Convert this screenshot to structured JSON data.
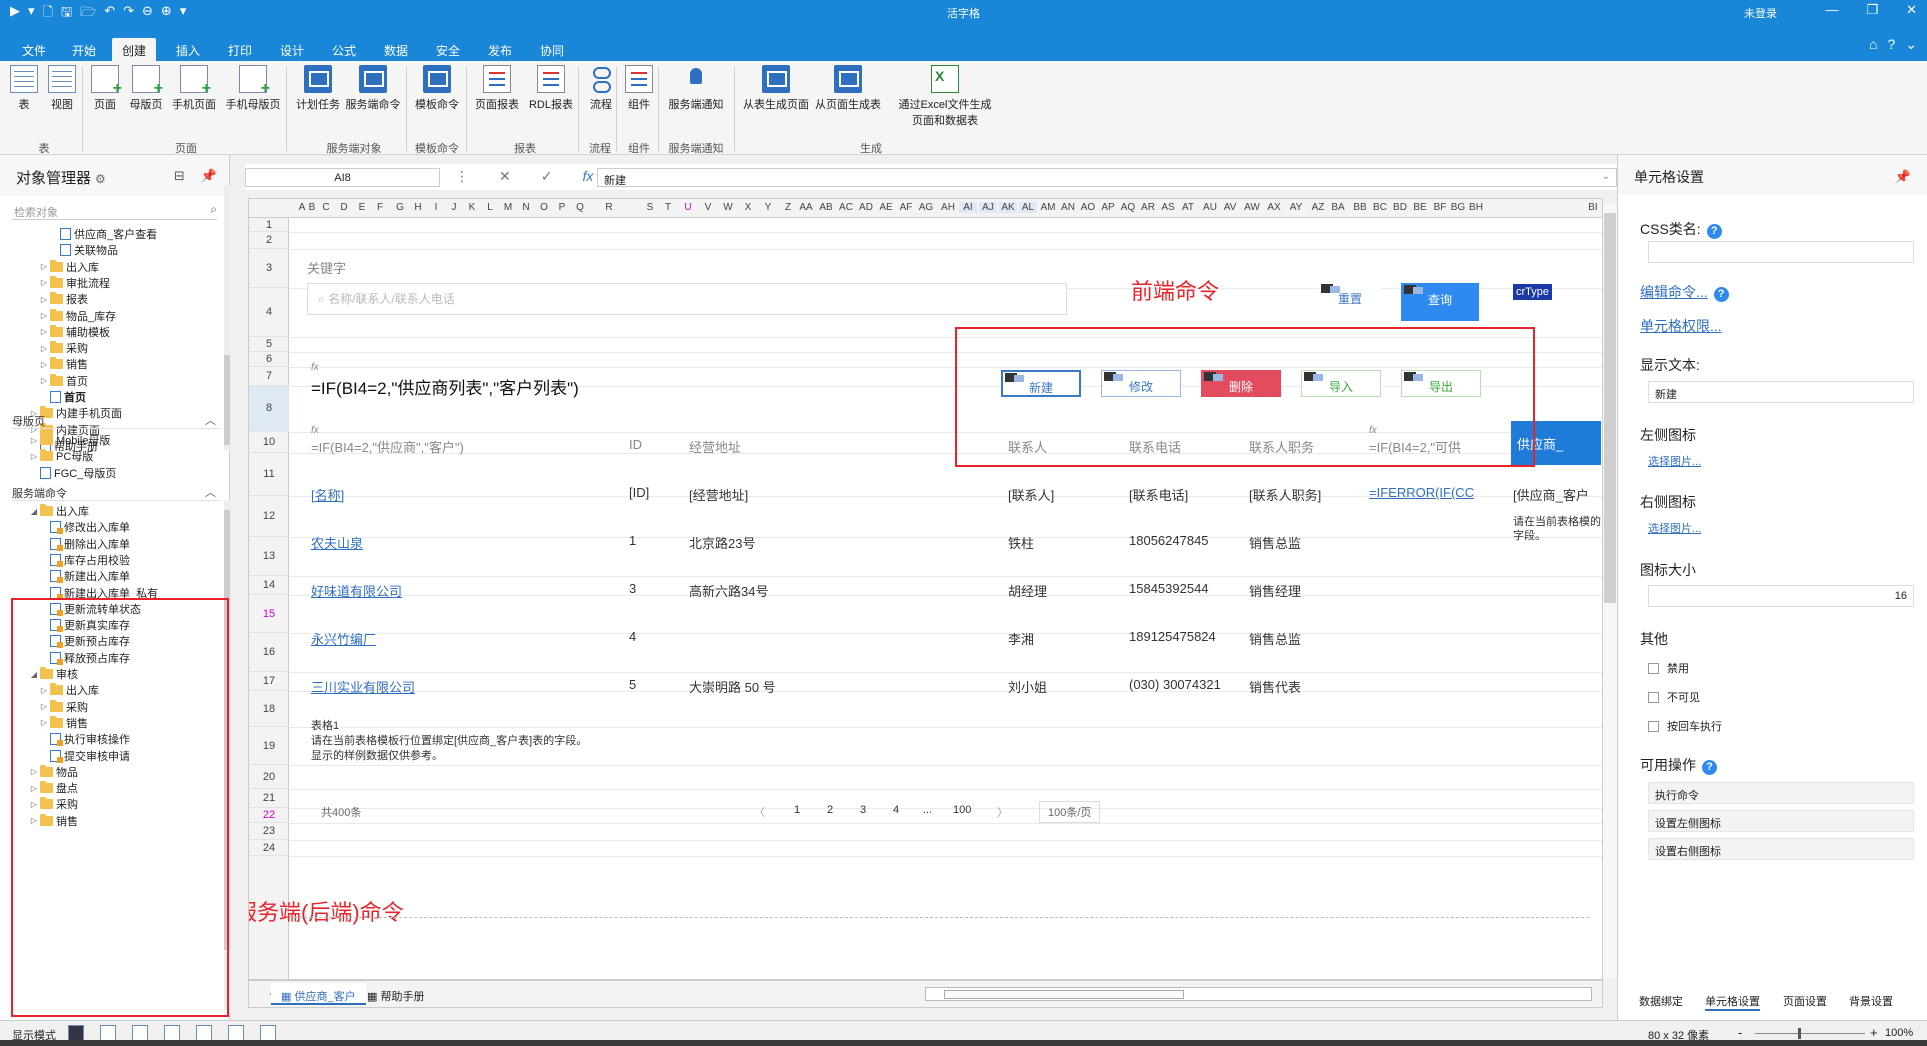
{
  "app": {
    "title": "活字格",
    "login_status": "未登录",
    "window_buttons": [
      "—",
      "❐",
      "✕"
    ]
  },
  "quick_access": [
    "▶",
    "▾",
    "🗋",
    "🖫",
    "🗁",
    "↶",
    "↷",
    "⊖",
    "⊕",
    "▾"
  ],
  "ribbon_tabs": [
    "文件",
    "开始",
    "创建",
    "插入",
    "打印",
    "设计",
    "公式",
    "数据",
    "安全",
    "发布",
    "协同"
  ],
  "ribbon_right_icons": [
    "⌂",
    "?",
    "⌄"
  ],
  "ribbon": {
    "buttons": [
      {
        "label": "表",
        "icon": "sheet-icon"
      },
      {
        "label": "视图",
        "icon": "view-icon"
      },
      {
        "label": "页面",
        "icon": "page-icon"
      },
      {
        "label": "母版页",
        "icon": "master-page-icon"
      },
      {
        "label": "手机页面",
        "icon": "mobile-page-icon"
      },
      {
        "label": "手机母版页",
        "icon": "mobile-master-icon"
      },
      {
        "label": "计划任务",
        "icon": "schedule-icon"
      },
      {
        "label": "服务端命令",
        "icon": "server-command-icon"
      },
      {
        "label": "模板命令",
        "icon": "template-command-icon"
      },
      {
        "label": "页面报表",
        "icon": "page-report-icon"
      },
      {
        "label": "RDL报表",
        "icon": "rdl-report-icon"
      },
      {
        "label": "流程",
        "icon": "flow-icon"
      },
      {
        "label": "组件",
        "icon": "component-icon"
      },
      {
        "label": "服务端通知",
        "icon": "notification-icon"
      },
      {
        "label": "从表生成页面",
        "icon": "gen-from-table-icon"
      },
      {
        "label": "从页面生成表",
        "icon": "gen-from-page-icon"
      },
      {
        "label": "通过Excel文件生成",
        "label2": "页面和数据表",
        "icon": "excel-icon"
      }
    ],
    "groups": [
      "表",
      "页面",
      "服务端对象",
      "模板命令",
      "报表",
      "流程",
      "组件",
      "服务端通知",
      "生成"
    ]
  },
  "object_manager": {
    "title": "对象管理器",
    "search_placeholder": "检索对象",
    "top_items": [
      {
        "label": "供应商_客户查看",
        "type": "page",
        "indent": 3
      },
      {
        "label": "关联物品",
        "type": "page",
        "indent": 3
      },
      {
        "label": "出入库",
        "type": "folder",
        "indent": 2
      },
      {
        "label": "审批流程",
        "type": "folder",
        "indent": 2
      },
      {
        "label": "报表",
        "type": "folder",
        "indent": 2
      },
      {
        "label": "物品_库存",
        "type": "folder",
        "indent": 2
      },
      {
        "label": "辅助模板",
        "type": "folder",
        "indent": 2
      },
      {
        "label": "采购",
        "type": "folder",
        "indent": 2
      },
      {
        "label": "销售",
        "type": "folder",
        "indent": 2
      },
      {
        "label": "首页",
        "type": "folder",
        "indent": 2
      },
      {
        "label": "首页",
        "type": "page",
        "indent": 2,
        "bold": true
      },
      {
        "label": "内建手机页面",
        "type": "folder",
        "indent": 1
      },
      {
        "label": "内建页面",
        "type": "folder",
        "indent": 1
      },
      {
        "label": "帮助手册",
        "type": "page",
        "indent": 1
      }
    ],
    "master_section": "母版页",
    "master_items": [
      {
        "label": "Mobile母版",
        "type": "folder",
        "indent": 1
      },
      {
        "label": "PC母版",
        "type": "folder",
        "indent": 1
      },
      {
        "label": "FGC_母版页",
        "type": "page",
        "indent": 1
      }
    ],
    "server_section": "服务端命令",
    "server_items": [
      {
        "label": "出入库",
        "type": "folder",
        "indent": 1,
        "open": true
      },
      {
        "label": "修改出入库单",
        "type": "cmd",
        "indent": 2
      },
      {
        "label": "删除出入库单",
        "type": "cmd",
        "indent": 2
      },
      {
        "label": "库存占用校验",
        "type": "cmd",
        "indent": 2
      },
      {
        "label": "新建出入库单",
        "type": "cmd",
        "indent": 2
      },
      {
        "label": "新建出入库单_私有",
        "type": "cmd",
        "indent": 2
      },
      {
        "label": "更新流转单状态",
        "type": "cmd",
        "indent": 2
      },
      {
        "label": "更新真实库存",
        "type": "cmd",
        "indent": 2
      },
      {
        "label": "更新预占库存",
        "type": "cmd",
        "indent": 2
      },
      {
        "label": "释放预占库存",
        "type": "cmd",
        "indent": 2
      },
      {
        "label": "审核",
        "type": "folder",
        "indent": 1,
        "open": true
      },
      {
        "label": "出入库",
        "type": "folder",
        "indent": 2
      },
      {
        "label": "采购",
        "type": "folder",
        "indent": 2
      },
      {
        "label": "销售",
        "type": "folder",
        "indent": 2
      },
      {
        "label": "执行审核操作",
        "type": "cmd",
        "indent": 2
      },
      {
        "label": "提交审核申请",
        "type": "cmd",
        "indent": 2
      },
      {
        "label": "物品",
        "type": "folder",
        "indent": 1
      },
      {
        "label": "盘点",
        "type": "folder",
        "indent": 1
      },
      {
        "label": "采购",
        "type": "folder",
        "indent": 1
      },
      {
        "label": "销售",
        "type": "folder",
        "indent": 1
      }
    ]
  },
  "formula_bar": {
    "cell_name": "AI8",
    "value": "新建"
  },
  "columns": [
    "A",
    "B",
    "C",
    "D",
    "E",
    "F",
    "G",
    "H",
    "I",
    "J",
    "K",
    "L",
    "M",
    "N",
    "O",
    "P",
    "Q",
    "R",
    "S",
    "T",
    "U",
    "V",
    "W",
    "X",
    "Y",
    "Z",
    "AA",
    "AB",
    "AC",
    "AD",
    "AE",
    "AF",
    "AG",
    "AH",
    "AI",
    "AJ",
    "AK",
    "AL",
    "AM",
    "AN",
    "AO",
    "AP",
    "AQ",
    "AR",
    "AS",
    "AT",
    "AU",
    "AV",
    "AW",
    "AX",
    "AY",
    "AZ",
    "BA",
    "BB",
    "BC",
    "BD",
    "BE",
    "BF",
    "BG",
    "BH",
    "BI"
  ],
  "rows": [
    "1",
    "2",
    "3",
    "4",
    "5",
    "6",
    "7",
    "8",
    "10",
    "11",
    "12",
    "13",
    "14",
    "15",
    "16",
    "17",
    "18",
    "19",
    "20",
    "21",
    "22",
    "23",
    "24"
  ],
  "sheet": {
    "keyword_label": "关键字",
    "search_placeholder": "名称/联系人/联系人电话",
    "formula_title": "=IF(BI4=2,\"供应商列表\",\"客户列表\")",
    "buttons": {
      "reset": "重置",
      "query": "查询",
      "new": "新建",
      "edit": "修改",
      "delete": "删除",
      "import": "导入",
      "export": "导出"
    },
    "crtype": "crType",
    "headers": {
      "name_formula": "=IF(BI4=2,\"供应商\",\"客户\")",
      "id": "ID",
      "address": "经营地址",
      "contact": "联系人",
      "phone": "联系电话",
      "title": "联系人职务",
      "extra_formula": "=IF(BI4=2,\"可供",
      "blue_cell": "供应商_"
    },
    "bindings": {
      "name": "[名称]",
      "id": "[ID]",
      "address": "[经营地址]",
      "contact": "[联系人]",
      "phone": "[联系电话]",
      "title": "[联系人职务]",
      "extra": "=IFERROR(IF(CC",
      "table": "[供应商_客户",
      "hint": "请在当前表格模的字段。"
    },
    "data_rows": [
      {
        "name": "农夫山泉",
        "id": "1",
        "address": "北京路23号",
        "contact": "铁柱",
        "phone": "18056247845",
        "title": "销售总监"
      },
      {
        "name": "好味道有限公司",
        "id": "3",
        "address": "高新六路34号",
        "contact": "胡经理",
        "phone": "15845392544",
        "title": "销售经理"
      },
      {
        "name": "永兴竹编厂",
        "id": "4",
        "address": "",
        "contact": "李湘",
        "phone": "189125475824",
        "title": "销售总监"
      },
      {
        "name": "三川实业有限公司",
        "id": "5",
        "address": "大崇明路 50 号",
        "contact": "刘小姐",
        "phone": "(030) 30074321",
        "title": "销售代表"
      }
    ],
    "table_note": [
      "表格1",
      "请在当前表格模板行位置绑定[供应商_客户表]表的字段。",
      "显示的样例数据仅供参考。"
    ],
    "pager": {
      "total": "共400条",
      "prev": "〈",
      "pages": [
        "1",
        "2",
        "3",
        "4",
        "...",
        "100"
      ],
      "next": "〉",
      "page_size": "100条/页"
    },
    "annotations": {
      "frontend": "前端命令",
      "backend": "服务端(后端)命令"
    }
  },
  "sheet_tabs": [
    "供应商_客户",
    "帮助手册"
  ],
  "sheet_nav": "◀ ▶",
  "cell_settings": {
    "title": "单元格设置",
    "css_label": "CSS类名:",
    "edit_command": "编辑命令...",
    "cell_permission": "单元格权限...",
    "display_text_label": "显示文本:",
    "display_text": "新建",
    "left_icon": "左侧图标",
    "right_icon": "右侧图标",
    "select_image": "选择图片...",
    "icon_size_label": "图标大小",
    "icon_size": "16",
    "other": "其他",
    "disabled": "禁用",
    "invisible": "不可见",
    "enter_exec": "按回车执行",
    "ops_label": "可用操作",
    "ops": [
      "执行命令",
      "设置左侧图标",
      "设置右侧图标"
    ],
    "tabs": [
      "数据绑定",
      "单元格设置",
      "页面设置",
      "背景设置"
    ]
  },
  "statusbar": {
    "mode": "显示模式",
    "cell_size": "80 x 32 像素",
    "zoom": "100%",
    "zoom_minus": "-",
    "zoom_plus": "+"
  }
}
